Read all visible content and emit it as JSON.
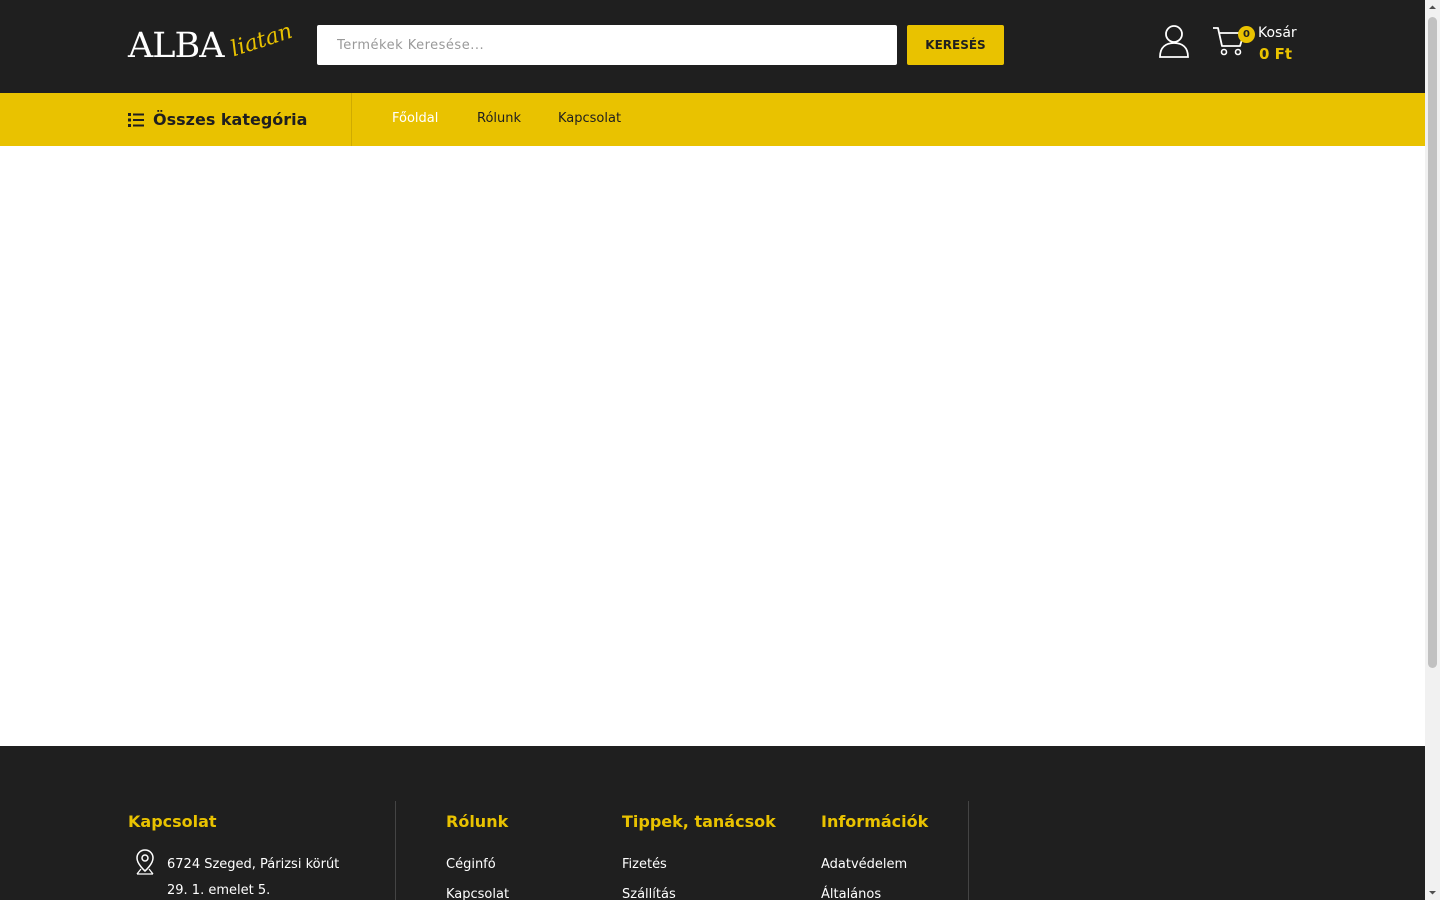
{
  "brand": {
    "logo_main": "ALBA",
    "logo_sub": "liatan"
  },
  "search": {
    "placeholder": "Termékek Keresése...",
    "value": "",
    "button_label": "KERESÉS"
  },
  "account": {
    "icon": "user-icon"
  },
  "cart": {
    "icon": "shopping-cart-icon",
    "count": "0",
    "label": "Kosár",
    "total": "0 Ft"
  },
  "nav": {
    "all_categories_label": "Összes kategória",
    "links": [
      {
        "label": "Főoldal",
        "active": true
      },
      {
        "label": "Rólunk",
        "active": false
      },
      {
        "label": "Kapcsolat",
        "active": false
      }
    ]
  },
  "footer": {
    "contact": {
      "heading": "Kapcsolat",
      "address_line1": "6724 Szeged, Párizsi körút",
      "address_line2": "29. 1. emelet 5."
    },
    "about": {
      "heading": "Rólunk",
      "links": [
        "Céginfó",
        "Kapcsolat"
      ]
    },
    "tips": {
      "heading": "Tippek, tanácsok",
      "links": [
        "Fizetés",
        "Szállítás"
      ]
    },
    "info": {
      "heading": "Információk",
      "links": [
        "Adatvédelem",
        "Általános"
      ]
    }
  },
  "colors": {
    "accent": "#e9c200",
    "dark": "#1f1f1f",
    "white": "#ffffff"
  }
}
